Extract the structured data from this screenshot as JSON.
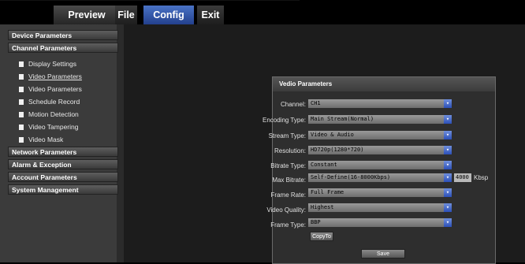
{
  "nav": {
    "tabs": [
      {
        "label": "Preview"
      },
      {
        "label": "File"
      },
      {
        "label": "Config"
      },
      {
        "label": "Exit"
      }
    ]
  },
  "sidebar": {
    "sections": [
      "Device Parameters",
      "Channel Parameters",
      "Network Parameters",
      "Alarm & Exception",
      "Account Parameters",
      "System Management"
    ],
    "channel_items": [
      "Display Settings",
      "Video Parameters",
      "Video Parameters",
      "Schedule Record",
      "Motion Detection",
      "Video Tampering",
      "Video Mask"
    ]
  },
  "panel": {
    "title": "Vedio Parameters",
    "fields": [
      {
        "label": "Channel:",
        "value": "CH1"
      },
      {
        "label": "Encoding Type:",
        "value": "Main Stream(Normal)"
      },
      {
        "label": "Stream Type:",
        "value": "Video & Audio"
      },
      {
        "label": "Resolution:",
        "value": "HD720p(1280*720)"
      },
      {
        "label": "Bitrate Type:",
        "value": "Constant"
      },
      {
        "label": "Max Bitrate:",
        "value": "Self-Define(16-8000Kbps)"
      },
      {
        "label": "Frame Rate:",
        "value": "Full Frame"
      },
      {
        "label": "Video Quality:",
        "value": "Highest"
      },
      {
        "label": "Frame Type:",
        "value": "BBP"
      }
    ],
    "bitrate_value": "4000",
    "bitrate_unit": "Kbsp",
    "copy_button": "CopyTo",
    "save_button": "Save"
  },
  "colors": {
    "active_tab": "#2f52a8",
    "background": "#1c1c1c",
    "sidebar": "#3b3b3b",
    "select_arrow": "#2c50b8"
  }
}
